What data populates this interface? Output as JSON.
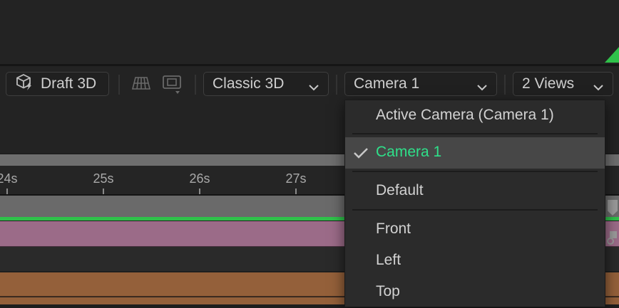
{
  "toolbar": {
    "draft3d_label": "Draft 3D",
    "renderer_value": "Classic 3D",
    "camera_value": "Camera 1",
    "views_value": "2 Views"
  },
  "ruler": {
    "ticks": [
      "24s",
      "25s",
      "26s",
      "27s"
    ]
  },
  "camera_menu": {
    "items": [
      {
        "label": "Active Camera (Camera 1)",
        "selected": false
      },
      {
        "label": "Camera 1",
        "selected": true
      },
      {
        "label": "Default",
        "selected": false
      },
      {
        "label": "Front",
        "selected": false
      },
      {
        "label": "Left",
        "selected": false
      },
      {
        "label": "Top",
        "selected": false
      }
    ]
  },
  "colors": {
    "accent_green": "#2fe08a",
    "timeline_green": "#2fc14a",
    "pink_track": "#9b6b88",
    "orange_track": "#94603a"
  },
  "icons": {
    "draft3d": "cube-lightning-icon",
    "grid": "grid-floor-icon",
    "view_options": "view-options-icon",
    "chevron": "chevron-down-icon",
    "check": "checkmark-icon"
  }
}
